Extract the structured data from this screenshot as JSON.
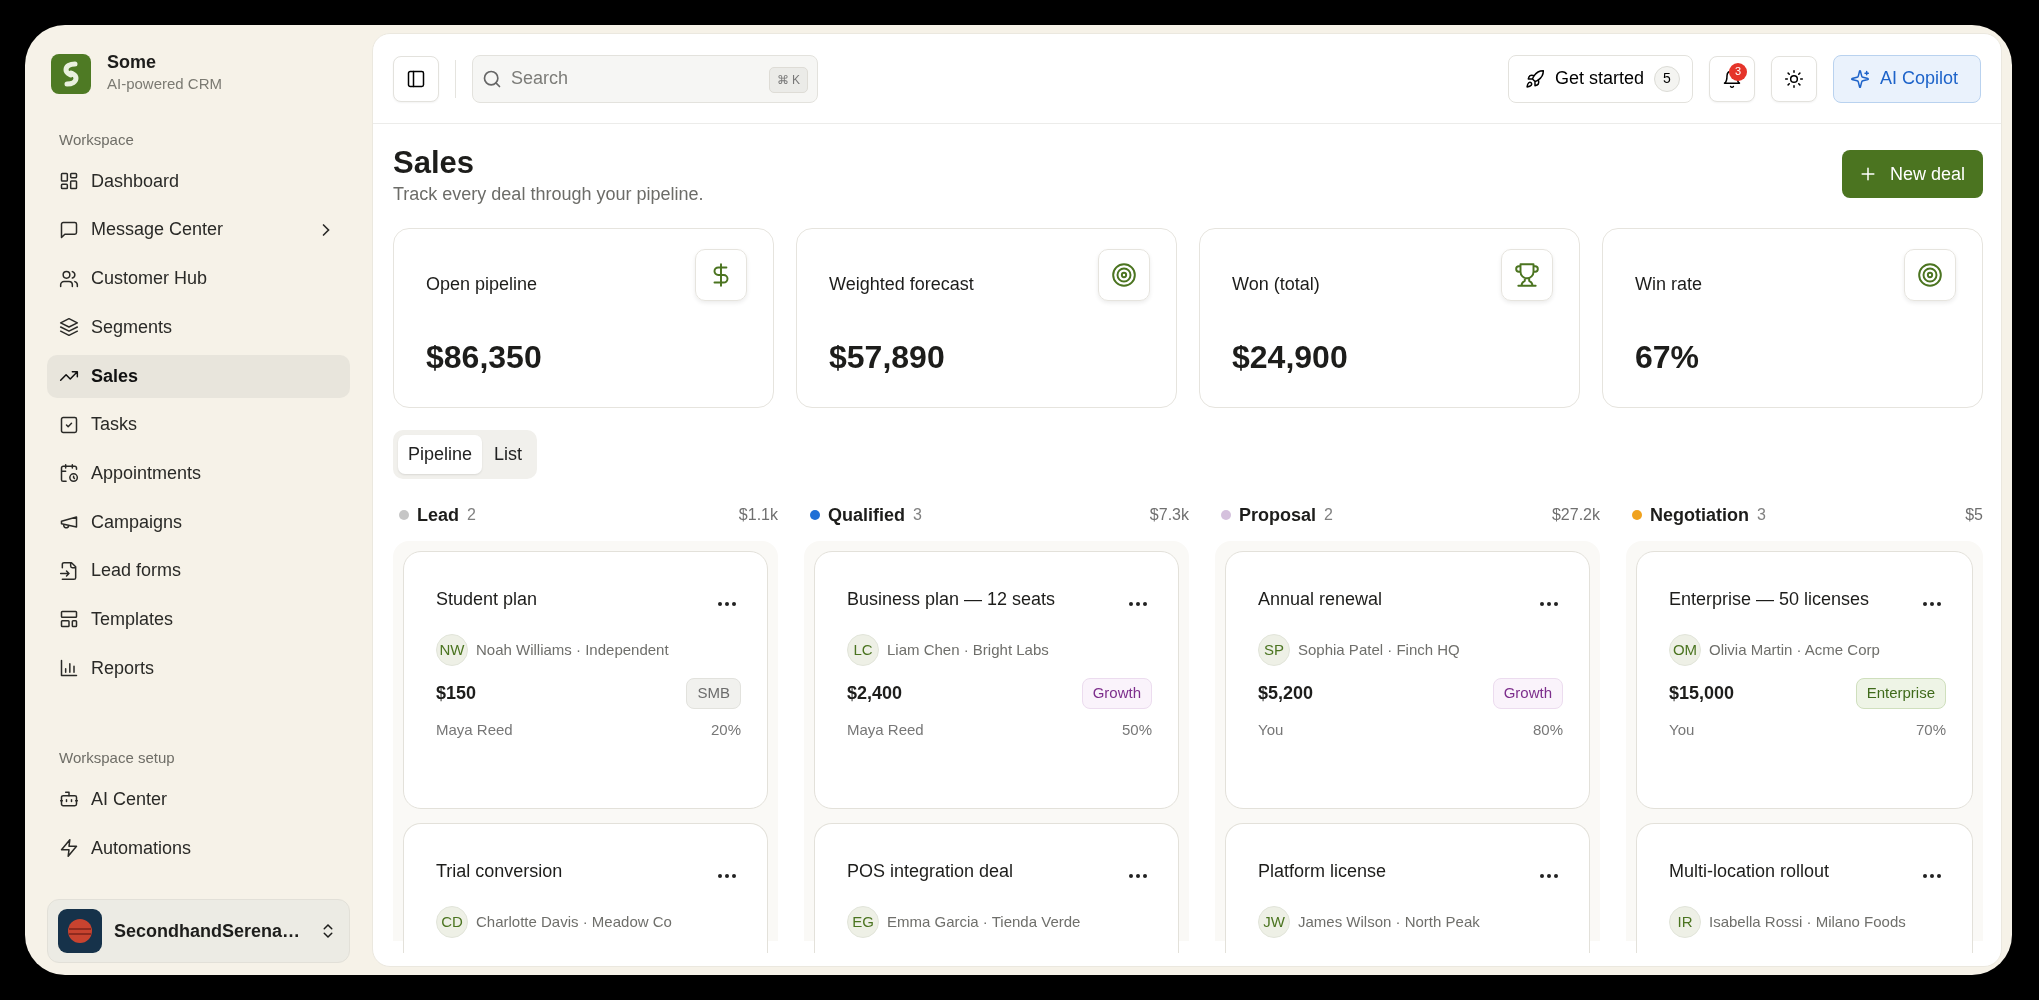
{
  "brand": {
    "name": "Some",
    "tagline": "AI-powered CRM"
  },
  "sidebar": {
    "sections": [
      {
        "heading": "Workspace",
        "items": [
          {
            "label": "Dashboard",
            "kind": "dashboard",
            "selected": false,
            "submenu": false
          },
          {
            "label": "Message Center",
            "kind": "message",
            "selected": false,
            "submenu": true
          },
          {
            "label": "Customer Hub",
            "kind": "users",
            "selected": false,
            "submenu": false
          },
          {
            "label": "Segments",
            "kind": "layers",
            "selected": false,
            "submenu": false
          },
          {
            "label": "Sales",
            "kind": "trend",
            "selected": true,
            "submenu": false
          },
          {
            "label": "Tasks",
            "kind": "checkbox",
            "selected": false,
            "submenu": false
          },
          {
            "label": "Appointments",
            "kind": "calendar",
            "selected": false,
            "submenu": false
          },
          {
            "label": "Campaigns",
            "kind": "megaphone",
            "selected": false,
            "submenu": false
          },
          {
            "label": "Lead forms",
            "kind": "fileinput",
            "selected": false,
            "submenu": false
          },
          {
            "label": "Templates",
            "kind": "template",
            "selected": false,
            "submenu": false
          },
          {
            "label": "Reports",
            "kind": "chart",
            "selected": false,
            "submenu": false
          }
        ]
      },
      {
        "heading": "Workspace setup",
        "items": [
          {
            "label": "AI Center",
            "kind": "bot",
            "selected": false,
            "submenu": false
          },
          {
            "label": "Automations",
            "kind": "zap",
            "selected": false,
            "submenu": false
          }
        ]
      }
    ]
  },
  "account": {
    "name": "SecondhandSerena…"
  },
  "topbar": {
    "search": {
      "placeholder": "Search",
      "shortcut": "⌘ K"
    },
    "get_started": {
      "label": "Get started",
      "count": "5"
    },
    "notifications": {
      "count": "3"
    },
    "copilot": "AI Copilot"
  },
  "header": {
    "title": "Sales",
    "subtitle": "Track every deal through your pipeline.",
    "action": "New deal"
  },
  "stats": [
    {
      "label": "Open pipeline",
      "value": "$86,350",
      "kind": "dollar"
    },
    {
      "label": "Weighted forecast",
      "value": "$57,890",
      "kind": "target"
    },
    {
      "label": "Won (total)",
      "value": "$24,900",
      "kind": "trophy"
    },
    {
      "label": "Win rate",
      "value": "67%",
      "kind": "target"
    }
  ],
  "view_tabs": [
    {
      "label": "Pipeline",
      "selected": true
    },
    {
      "label": "List",
      "selected": false
    }
  ],
  "columns": [
    {
      "name": "Lead",
      "count": "2",
      "total": "$1.1k",
      "color": "#c6c6c6",
      "deals": [
        {
          "title": "Student plan",
          "initials": "NW",
          "contact": "Noah Williams · Independent",
          "amount": "$150",
          "tier": {
            "label": "SMB",
            "kind": "smb"
          },
          "owner": "Maya Reed",
          "probability": "20%"
        },
        {
          "title": "Trial conversion",
          "initials": "CD",
          "contact": "Charlotte Davis · Meadow Co"
        }
      ]
    },
    {
      "name": "Qualified",
      "count": "3",
      "total": "$7.3k",
      "color": "#1f6fd6",
      "deals": [
        {
          "title": "Business plan — 12 seats",
          "initials": "LC",
          "contact": "Liam Chen · Bright Labs",
          "amount": "$2,400",
          "tier": {
            "label": "Growth",
            "kind": "growth"
          },
          "owner": "Maya Reed",
          "probability": "50%"
        },
        {
          "title": "POS integration deal",
          "initials": "EG",
          "contact": "Emma Garcia · Tienda Verde"
        }
      ]
    },
    {
      "name": "Proposal",
      "count": "2",
      "total": "$27.2k",
      "color": "#d5c1dd",
      "deals": [
        {
          "title": "Annual renewal",
          "initials": "SP",
          "contact": "Sophia Patel · Finch HQ",
          "amount": "$5,200",
          "tier": {
            "label": "Growth",
            "kind": "growth"
          },
          "owner": "You",
          "probability": "80%"
        },
        {
          "title": "Platform license",
          "initials": "JW",
          "contact": "James Wilson · North Peak"
        }
      ]
    },
    {
      "name": "Negotiation",
      "count": "3",
      "total": "$5",
      "color": "#f0a21e",
      "deals": [
        {
          "title": "Enterprise — 50 licenses",
          "initials": "OM",
          "contact": "Olivia Martin · Acme Corp",
          "amount": "$15,000",
          "tier": {
            "label": "Enterprise",
            "kind": "enterprise"
          },
          "owner": "You",
          "probability": "70%"
        },
        {
          "title": "Multi-location rollout",
          "initials": "IR",
          "contact": "Isabella Rossi · Milano Foods"
        }
      ]
    }
  ]
}
